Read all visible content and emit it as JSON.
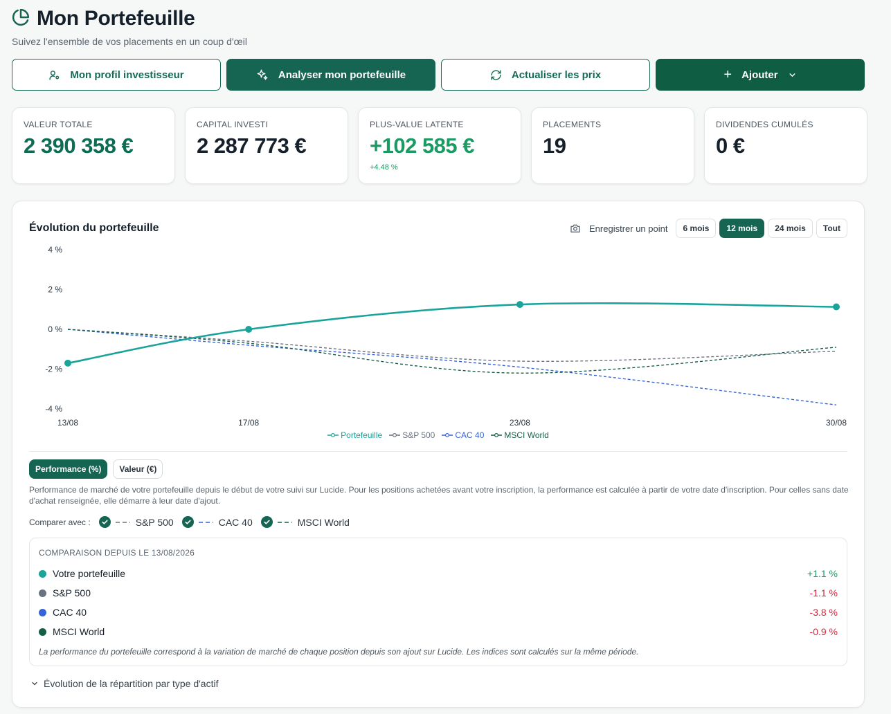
{
  "header": {
    "title": "Mon Portefeuille",
    "subtitle": "Suivez l'ensemble de vos placements en un coup d'œil"
  },
  "actions": {
    "profile": "Mon profil investisseur",
    "analyze": "Analyser mon portefeuille",
    "refresh": "Actualiser les prix",
    "add": "Ajouter"
  },
  "stats": [
    {
      "label": "VALEUR TOTALE",
      "value": "2 390 358 €",
      "color": "#0e6b54"
    },
    {
      "label": "CAPITAL INVESTI",
      "value": "2 287 773 €",
      "color": "#15202b"
    },
    {
      "label": "PLUS-VALUE LATENTE",
      "value": "+102 585 €",
      "sub": "+4.48 %",
      "color": "#1b9a64"
    },
    {
      "label": "PLACEMENTS",
      "value": "19",
      "color": "#15202b"
    },
    {
      "label": "DIVIDENDES CUMULÉS",
      "value": "0 €",
      "color": "#15202b"
    }
  ],
  "chart_section": {
    "title": "Évolution du portefeuille",
    "snapshot_label": "Enregistrer un point",
    "ranges": [
      "6 mois",
      "12 mois",
      "24 mois",
      "Tout"
    ],
    "active_range": "12 mois"
  },
  "chart_data": {
    "type": "line",
    "x": [
      "13/08",
      "17/08",
      "23/08",
      "30/08"
    ],
    "ylim": [
      -4,
      4
    ],
    "yticks": [
      4,
      2,
      0,
      -2,
      -4
    ],
    "ytick_labels": [
      "4 %",
      "2 %",
      "0 %",
      "-2 %",
      "-4 %"
    ],
    "grid": false,
    "legend_position": "bottom",
    "series": [
      {
        "name": "Portefeuille",
        "color": "#1aa39a",
        "style": "solid",
        "values": [
          -1.7,
          0.0,
          1.25,
          1.13
        ]
      },
      {
        "name": "S&P 500",
        "color": "#6b7280",
        "style": "dashed",
        "values": [
          0.0,
          -0.6,
          -1.6,
          -1.1
        ]
      },
      {
        "name": "CAC 40",
        "color": "#3563d8",
        "style": "dashed",
        "values": [
          0.0,
          -0.8,
          -1.9,
          -3.8
        ]
      },
      {
        "name": "MSCI World",
        "color": "#155e49",
        "style": "dashed",
        "values": [
          0.0,
          -0.7,
          -2.2,
          -0.9
        ]
      }
    ]
  },
  "modes": {
    "performance": "Performance (%)",
    "value": "Valeur (€)",
    "active": "performance"
  },
  "perf_note": "Performance de marché de votre portefeuille depuis le début de votre suivi sur Lucide. Pour les positions achetées avant votre inscription, la performance est calculée à partir de votre date d'inscription. Pour celles sans date d'achat renseignée, elle démarre à leur date d'ajout.",
  "compare": {
    "label": "Comparer avec :",
    "options": [
      {
        "name": "S&P 500",
        "color": "#6b7280",
        "checked": true
      },
      {
        "name": "CAC 40",
        "color": "#3563d8",
        "checked": true
      },
      {
        "name": "MSCI World",
        "color": "#155e49",
        "checked": true
      }
    ]
  },
  "comparison": {
    "title": "COMPARAISON DEPUIS LE 13/08/2026",
    "rows": [
      {
        "name": "Votre portefeuille",
        "value": "+1.1 %",
        "color": "#1aa39a",
        "sign": "pos"
      },
      {
        "name": "S&P 500",
        "value": "-1.1 %",
        "color": "#6b7280",
        "sign": "neg"
      },
      {
        "name": "CAC 40",
        "value": "-3.8 %",
        "color": "#3563d8",
        "sign": "neg"
      },
      {
        "name": "MSCI World",
        "value": "-0.9 %",
        "color": "#155e49",
        "sign": "neg"
      }
    ],
    "footnote": "La performance du portefeuille correspond à la variation de marché de chaque position depuis son ajout sur Lucide. Les indices sont calculés sur la même période."
  },
  "expander": {
    "label": "Évolution de la répartition par type d'actif"
  }
}
